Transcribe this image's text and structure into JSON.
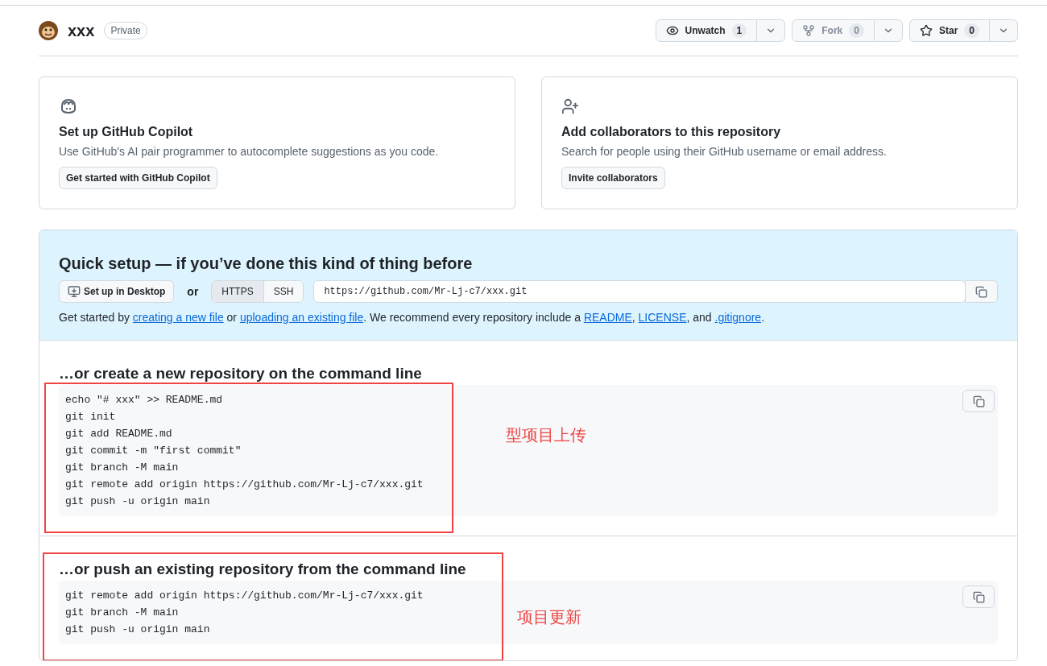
{
  "repo": {
    "name": "xxx",
    "visibility": "Private"
  },
  "actions": [
    {
      "kind": "watch",
      "label": "Unwatch",
      "count": "1",
      "disabled": false
    },
    {
      "kind": "fork",
      "label": "Fork",
      "count": "0",
      "disabled": true
    },
    {
      "kind": "star",
      "label": "Star",
      "count": "0",
      "disabled": false
    }
  ],
  "cards": [
    {
      "kind": "copilot",
      "title": "Set up GitHub Copilot",
      "description": "Use GitHub's AI pair programmer to autocomplete suggestions as you code.",
      "button": "Get started with GitHub Copilot"
    },
    {
      "kind": "collaborators",
      "title": "Add collaborators to this repository",
      "description": "Search for people using their GitHub username or email address.",
      "button": "Invite collaborators"
    }
  ],
  "quick_setup": {
    "title": "Quick setup — if you’ve done this kind of thing before",
    "desktop_button": "Set up in Desktop",
    "or": "or",
    "protocols": [
      {
        "label": "HTTPS",
        "selected": true
      },
      {
        "label": "SSH",
        "selected": false
      }
    ],
    "url": "https://github.com/Mr-Lj-c7/xxx.git",
    "help": [
      {
        "text": "Get started by ",
        "kind": "text"
      },
      {
        "text": "creating a new file",
        "kind": "link"
      },
      {
        "text": " or ",
        "kind": "text"
      },
      {
        "text": "uploading an existing file",
        "kind": "link"
      },
      {
        "text": ". We recommend every repository include a ",
        "kind": "text"
      },
      {
        "text": "README",
        "kind": "link"
      },
      {
        "text": ", ",
        "kind": "text"
      },
      {
        "text": "LICENSE",
        "kind": "link"
      },
      {
        "text": ", and ",
        "kind": "text"
      },
      {
        "text": ".gitignore",
        "kind": "link"
      },
      {
        "text": ".",
        "kind": "text"
      }
    ]
  },
  "sections": [
    {
      "title": "…or create a new repository on the command line",
      "code": [
        "echo \"# xxx\" >> README.md",
        "git init",
        "git add README.md",
        "git commit -m \"first commit\"",
        "git branch -M main",
        "git remote add origin https://github.com/Mr-Lj-c7/xxx.git",
        "git push -u origin main"
      ],
      "annotation": "型项目上传"
    },
    {
      "title": "…or push an existing repository from the command line",
      "code": [
        "git remote add origin https://github.com/Mr-Lj-c7/xxx.git",
        "git branch -M main",
        "git push -u origin main"
      ],
      "annotation": "项目更新"
    }
  ]
}
